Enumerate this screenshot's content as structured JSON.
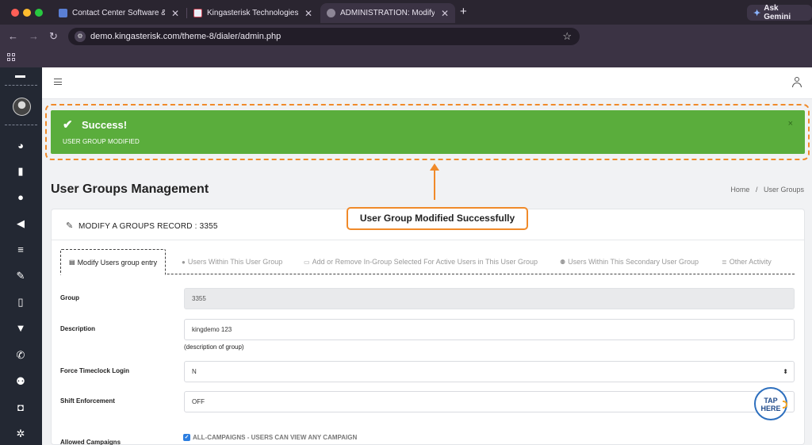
{
  "browser": {
    "tabs": [
      {
        "title": "Contact Center Software & V",
        "close": "✕"
      },
      {
        "title": "Kingasterisk Technologies | L",
        "close": "✕"
      },
      {
        "title": "ADMINISTRATION: Modify Us",
        "close": "✕"
      }
    ],
    "new_tab": "+",
    "ask_gemini": "Ask Gemini",
    "url": "demo.kingasterisk.com/theme-8/dialer/admin.php",
    "nav": {
      "back": "←",
      "forward": "→",
      "reload": "↻"
    },
    "bookmark_star": "☆"
  },
  "sidebar": {
    "icons": [
      "dashboard-icon",
      "file-icon",
      "user-icon",
      "megaphone-icon",
      "list-icon",
      "edit-icon",
      "document-icon",
      "filter-icon",
      "phone-icon",
      "users-icon",
      "bag-icon",
      "gear-icon"
    ]
  },
  "alert": {
    "check": "✔",
    "heading": "Success!",
    "message": "USER GROUP MODIFIED",
    "close": "×",
    "color": "#5aad3c"
  },
  "annotation": {
    "callout": "User Group Modified Successfully",
    "accent": "#f08a2a"
  },
  "page": {
    "title": "User Groups Management",
    "breadcrumb": [
      "Home",
      "User Groups"
    ],
    "breadcrumb_sep": "/"
  },
  "card": {
    "title": "MODIFY A GROUPS RECORD : 3355",
    "tabs": [
      {
        "label": "Modify Users group entry",
        "icon": "file-icon",
        "active": true
      },
      {
        "label": "Users Within This User Group",
        "icon": "user-icon",
        "active": false
      },
      {
        "label": "Add or Remove In-Group Selected For Active Users in This User Group",
        "icon": "id-card-icon",
        "active": false
      },
      {
        "label": "Users Within This Secondary User Group",
        "icon": "users-icon",
        "active": false
      },
      {
        "label": "Other Activity",
        "icon": "list-icon",
        "active": false
      }
    ],
    "form": {
      "group": {
        "label": "Group",
        "value": "3355"
      },
      "description": {
        "label": "Description",
        "value": "kingdemo 123",
        "hint": "(description of group)"
      },
      "force_timeclock": {
        "label": "Force Timeclock Login",
        "value": "N"
      },
      "shift_enforcement": {
        "label": "Shift Enforcement",
        "value": "OFF"
      },
      "allowed_campaigns": {
        "label": "Allowed Campaigns",
        "option": "ALL-CAMPAIGNS - USERS CAN VIEW ANY CAMPAIGN",
        "checked": true
      }
    }
  },
  "tap_here": {
    "line1": "TAP",
    "line2": "HERE"
  }
}
